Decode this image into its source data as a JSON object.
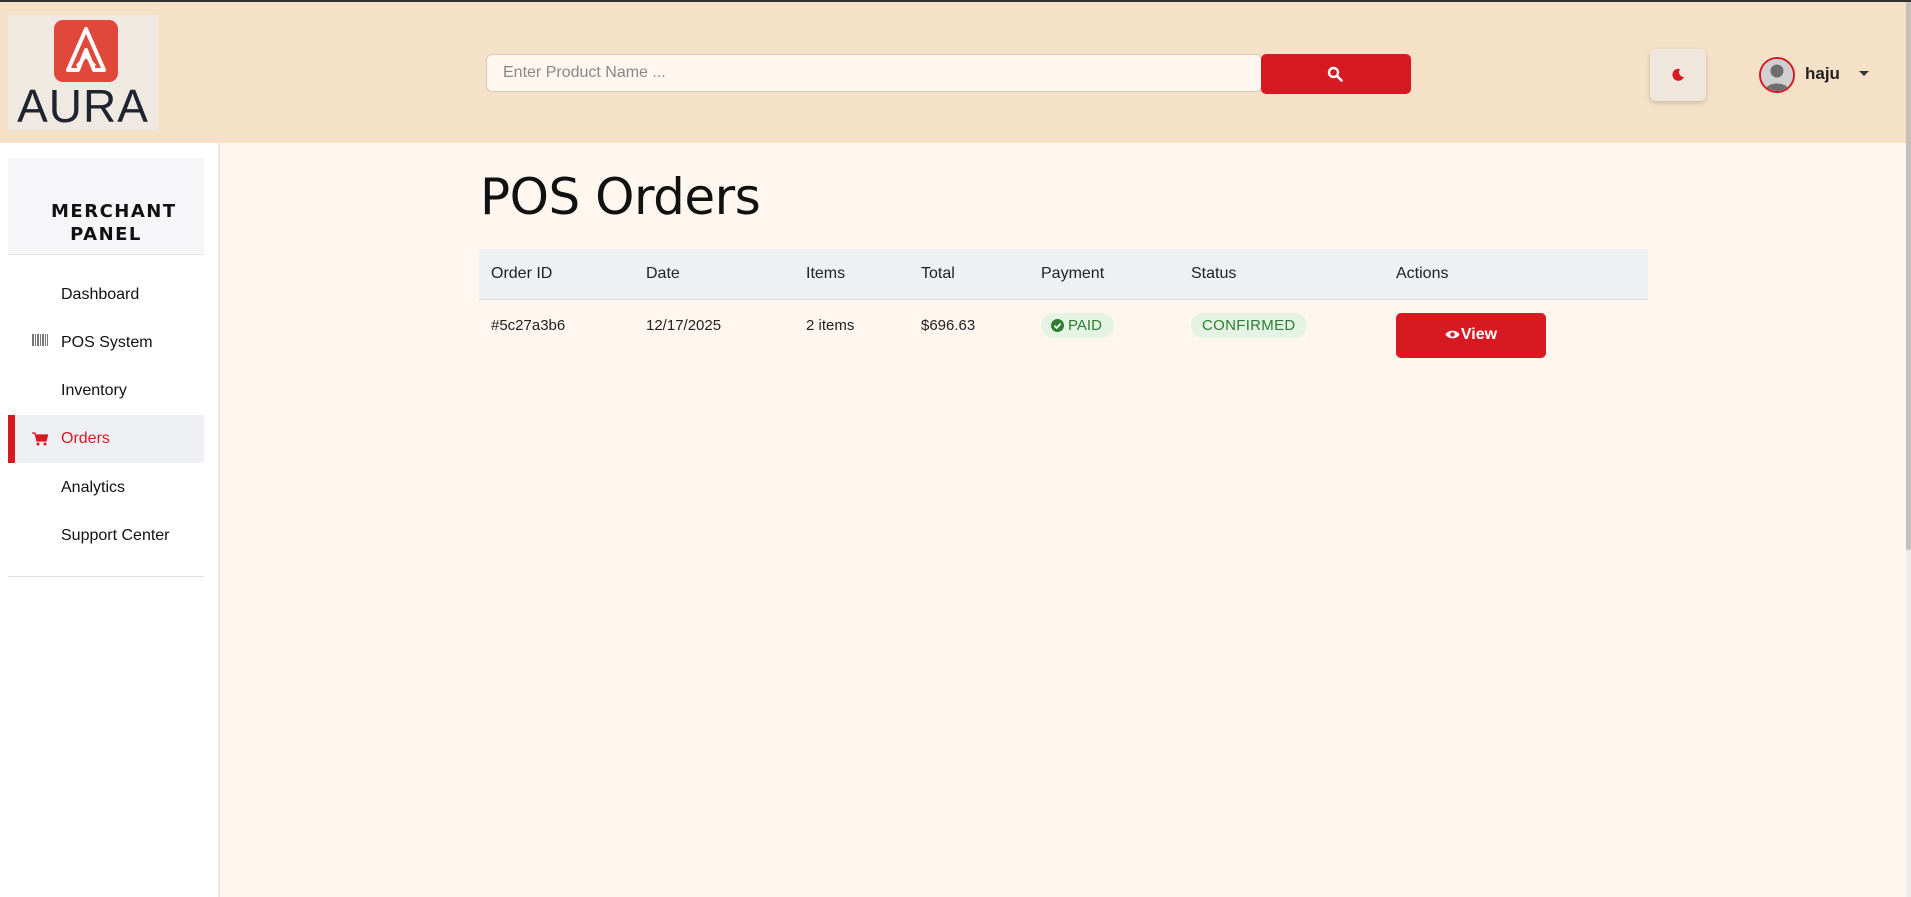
{
  "brand": {
    "name": "AURA",
    "accent": "#d71a21"
  },
  "search": {
    "placeholder": "Enter Product Name ..."
  },
  "user": {
    "name": "haju"
  },
  "sidebar": {
    "title": "MERCHANT PANEL",
    "items": [
      {
        "label": "Dashboard",
        "icon": ""
      },
      {
        "label": "POS System",
        "icon": "barcode-icon"
      },
      {
        "label": "Inventory",
        "icon": ""
      },
      {
        "label": "Orders",
        "icon": "shopping-cart-icon",
        "active": true
      },
      {
        "label": "Analytics",
        "icon": ""
      },
      {
        "label": "Support Center",
        "icon": ""
      }
    ]
  },
  "main": {
    "title": "POS Orders",
    "table": {
      "headers": [
        "Order ID",
        "Date",
        "Items",
        "Total",
        "Payment",
        "Status",
        "Actions"
      ],
      "rows": [
        {
          "order_id": "#5c27a3b6",
          "date": "12/17/2025",
          "items": "2 items",
          "total": "$696.63",
          "payment": "PAID",
          "status": "CONFIRMED",
          "action": "View"
        }
      ]
    }
  }
}
